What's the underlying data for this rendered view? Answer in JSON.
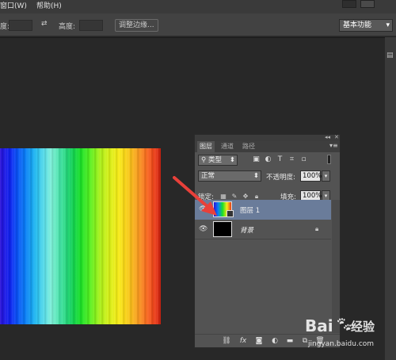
{
  "menu": {
    "items": [
      "窗口(W)",
      "帮助(H)"
    ],
    "controls": {
      "minimize": "—",
      "maximize": "□",
      "close": "✕"
    }
  },
  "options_bar": {
    "partial_label": "度:",
    "swap_icon": "swap-icon",
    "height_label": "高度:",
    "refine_edge_button": "调整边缘...",
    "workspace": "基本功能",
    "workspace_arrow": "▾"
  },
  "layers_panel": {
    "tabs": [
      "图层",
      "通道",
      "路径"
    ],
    "active_tab": "图层",
    "collapse_glyph": "◂◂",
    "close_glyph": "✕",
    "menu_glyph": "▾≡",
    "filter_kind": "类型",
    "filter_icons": [
      "image-filter-icon",
      "adjustment-filter-icon",
      "type-filter-icon",
      "shape-filter-icon",
      "smart-object-filter-icon"
    ],
    "blend_mode": "正常",
    "opacity_label": "不透明度:",
    "opacity_value": "100%",
    "lock_label": "锁定:",
    "fill_label": "填充:",
    "fill_value": "100%",
    "layers": [
      {
        "name": "图层 1",
        "selected": true,
        "visible": true
      },
      {
        "name": "背景",
        "selected": false,
        "visible": true,
        "locked": true
      }
    ],
    "footer_icons": [
      "link-icon",
      "fx-icon",
      "mask-icon",
      "adjustment-icon",
      "group-icon",
      "new-layer-icon",
      "trash-icon"
    ]
  },
  "watermark": {
    "brand": "Bai",
    "brand2": "经验",
    "url": "jingyan.baidu.com"
  },
  "colors": {
    "selected_layer": "#6a7c9a",
    "arrow": "#e8403a",
    "panel_bg": "#535353"
  }
}
